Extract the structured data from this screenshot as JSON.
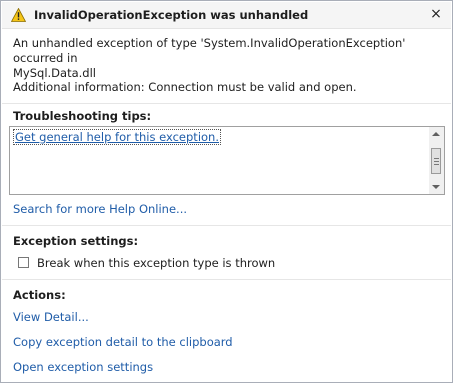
{
  "dialog": {
    "title": "InvalidOperationException was unhandled",
    "close_glyph": "×",
    "message_line1": "An unhandled exception of type 'System.InvalidOperationException' occurred in",
    "message_line2": "MySql.Data.dll",
    "additional_info": "Additional information: Connection must be valid and open.",
    "warning_icon_color": "#f5c518"
  },
  "troubleshooting": {
    "heading": "Troubleshooting tips:",
    "tips": [
      "Get general help for this exception."
    ],
    "search_link": "Search for more Help Online..."
  },
  "exception_settings": {
    "heading": "Exception settings:",
    "break_checkbox_label": "Break when this exception type is thrown",
    "break_checked": false
  },
  "actions": {
    "heading": "Actions:",
    "items": [
      "View Detail...",
      "Copy exception detail to the clipboard",
      "Open exception settings"
    ]
  },
  "colors": {
    "link": "#1f5ca8",
    "title_bar": "#f5f5f5"
  }
}
